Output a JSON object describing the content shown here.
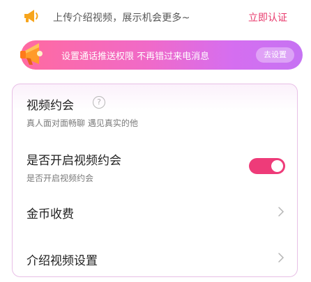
{
  "notice": {
    "icon": "megaphone-icon",
    "text": "上传介绍视频，展示机会更多~",
    "link": "立即认证",
    "link_color": "#e8386b"
  },
  "push_banner": {
    "icon": "speaker-icon",
    "text": "设置通话推送权限  不再错过来电消息",
    "button": "去设置"
  },
  "settings": {
    "video_date": {
      "title": "视频约会",
      "help": "?",
      "subtitle": "真人面对面畅聊 遇见真实的他"
    },
    "enable_video_date": {
      "title": "是否开启视频约会",
      "subtitle": "是否开启视频约会",
      "enabled": true,
      "accent": "#ee3b79"
    },
    "coin_fee": {
      "title": "金币收费"
    },
    "intro_video": {
      "title": "介绍视频设置"
    }
  }
}
